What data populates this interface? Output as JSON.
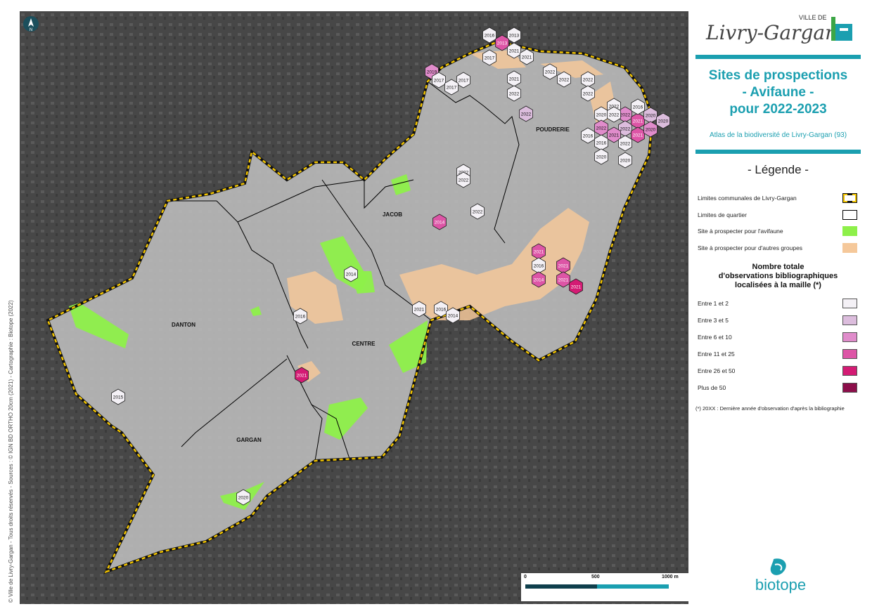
{
  "header": {
    "logo_top": "VILLE DE",
    "logo_name": "Livry-Gargan",
    "title_lines": [
      "Sites de prospections",
      "- Avifaune -",
      "pour 2022-2023"
    ],
    "subtitle": "Atlas de la biodiversité de Livry-Gargan (93)"
  },
  "legend": {
    "title": "- Légende -",
    "items": [
      {
        "label": "Limites communales de Livry-Gargan",
        "color": "#f2c400",
        "kind": "commune-limit"
      },
      {
        "label": "Limites de quartier",
        "color": "#000000",
        "kind": "outline"
      },
      {
        "label": "Site à prospecter pour l'avifaune",
        "color": "#8ef04a",
        "kind": "fill"
      },
      {
        "label": "Site à prospecter pour d'autres groupes",
        "color": "#f5c89a",
        "kind": "fill"
      }
    ],
    "classes_heading": [
      "Nombre totale",
      "d'observations bibliographiques",
      "localisées à la maille (*)"
    ],
    "classes": [
      {
        "label": "Entre 1 et 2",
        "color": "#f4f1f6"
      },
      {
        "label": "Entre 3 et 5",
        "color": "#dcbddd"
      },
      {
        "label": "Entre 6 et 10",
        "color": "#e08ccb"
      },
      {
        "label": "Entre 11 et 25",
        "color": "#dd55a6"
      },
      {
        "label": "Entre 26 et 50",
        "color": "#d41b74"
      },
      {
        "label": "Plus de 50",
        "color": "#8c0e4a"
      }
    ],
    "note": "(*) 20XX : Dernière année d'observation d'après la bibliographie"
  },
  "credits": "© Ville de Livry-Gargan - Tous droits réservés - Sources : © IGN BD ORTHO 20cm (2021) - Cartographie : Biotope (2022)",
  "scale": {
    "labels": [
      "0",
      "500",
      "1000 m"
    ]
  },
  "brand": "biotope",
  "map": {
    "districts": [
      "POUDRERIE",
      "JACOB",
      "DANTON",
      "CENTRE",
      "GARGAN"
    ],
    "cells": [
      {
        "y": "2016",
        "c": 0
      },
      {
        "y": "2013",
        "c": 0
      },
      {
        "y": "2013",
        "c": 3
      },
      {
        "y": "2017",
        "c": 0
      },
      {
        "y": "2021",
        "c": 0
      },
      {
        "y": "2021",
        "c": 0
      },
      {
        "y": "2019",
        "c": 2
      },
      {
        "y": "2017",
        "c": 0
      },
      {
        "y": "2017",
        "c": 0
      },
      {
        "y": "2017",
        "c": 0
      },
      {
        "y": "2021",
        "c": 0
      },
      {
        "y": "2022",
        "c": 0
      },
      {
        "y": "2022",
        "c": 0
      },
      {
        "y": "2022",
        "c": 0
      },
      {
        "y": "2022",
        "c": 0
      },
      {
        "y": "2022",
        "c": 0
      },
      {
        "y": "2022",
        "c": 1
      },
      {
        "y": "2016",
        "c": 0
      },
      {
        "y": "2020",
        "c": 0
      },
      {
        "y": "2022",
        "c": 0
      },
      {
        "y": "2022",
        "c": 2
      },
      {
        "y": "2022",
        "c": 1
      },
      {
        "y": "2021",
        "c": 3
      },
      {
        "y": "2020",
        "c": 1
      },
      {
        "y": "2022",
        "c": 2
      },
      {
        "y": "2021",
        "c": 2
      },
      {
        "y": "2021",
        "c": 3
      },
      {
        "y": "2020",
        "c": 2
      },
      {
        "y": "2016",
        "c": 0
      },
      {
        "y": "2020",
        "c": 1
      },
      {
        "y": "2022",
        "c": 0
      },
      {
        "y": "2016",
        "c": 0
      },
      {
        "y": "2020",
        "c": 0
      },
      {
        "y": "2022",
        "c": 0
      },
      {
        "y": "2020",
        "c": 0
      },
      {
        "y": "2014",
        "c": 3
      },
      {
        "y": "2022",
        "c": 0
      },
      {
        "y": "2022",
        "c": 0
      },
      {
        "y": "2022",
        "c": 0
      },
      {
        "y": "2021",
        "c": 3
      },
      {
        "y": "2016",
        "c": 0
      },
      {
        "y": "2014",
        "c": 3
      },
      {
        "y": "2021",
        "c": 3
      },
      {
        "y": "2021",
        "c": 3
      },
      {
        "y": "2021",
        "c": 4
      },
      {
        "y": "2014",
        "c": 0
      },
      {
        "y": "2021",
        "c": 0
      },
      {
        "y": "2016",
        "c": 0
      },
      {
        "y": "2014",
        "c": 0
      },
      {
        "y": "2016",
        "c": 0
      },
      {
        "y": "2021",
        "c": 4
      },
      {
        "y": "2015",
        "c": 0
      },
      {
        "y": "2020",
        "c": 0
      }
    ]
  }
}
